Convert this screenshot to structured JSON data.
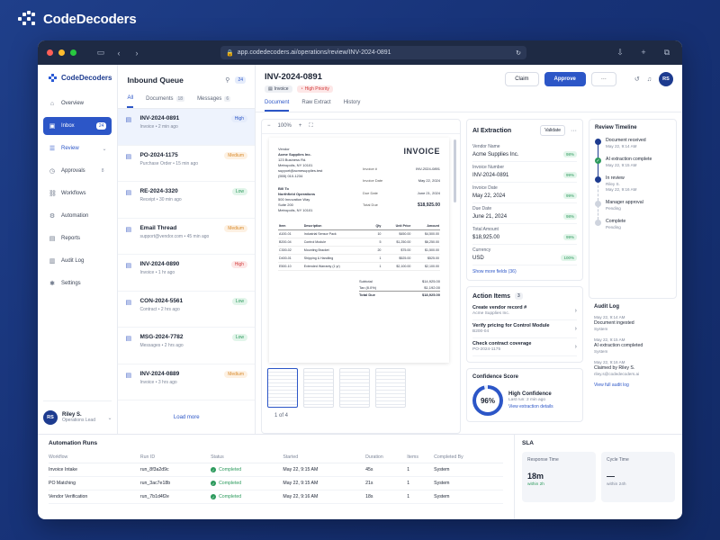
{
  "brand": {
    "name": "CodeDecoders"
  },
  "browser": {
    "url": "app.codedecoders.ai/operations/review/INV-2024-0891"
  },
  "sidebar": {
    "brand": "CodeDecoders",
    "items": [
      {
        "label": "Overview",
        "icon": "home-icon"
      },
      {
        "label": "Inbox",
        "icon": "inbox-icon",
        "count": "24"
      },
      {
        "label": "Review",
        "icon": "review-icon"
      },
      {
        "label": "Approvals",
        "icon": "approvals-icon",
        "count": "8"
      },
      {
        "label": "Workflows",
        "icon": "workflow-icon"
      },
      {
        "label": "Automation",
        "icon": "automation-icon"
      },
      {
        "label": "Reports",
        "icon": "reports-icon"
      },
      {
        "label": "Audit Log",
        "icon": "audit-icon"
      },
      {
        "label": "Settings",
        "icon": "gear-icon"
      }
    ],
    "user": {
      "initials": "RS",
      "name": "Riley S.",
      "role": "Operations Lead"
    }
  },
  "queue": {
    "title": "Inbound Queue",
    "count": "24",
    "tabs": [
      {
        "label": "All"
      },
      {
        "label": "Documents",
        "count": "18"
      },
      {
        "label": "Messages",
        "count": "6"
      }
    ],
    "items": [
      {
        "title": "INV-2024-0891",
        "sub": "Invoice • 2 min ago",
        "priority": "High",
        "kind": "high b"
      },
      {
        "title": "PO-2024-1175",
        "sub": "Purchase Order • 15 min ago",
        "priority": "Medium",
        "kind": "medium"
      },
      {
        "title": "RE-2024-3320",
        "sub": "Receipt • 30 min ago",
        "priority": "Low",
        "kind": "low"
      },
      {
        "title": "Email Thread",
        "sub": "support@vendor.com • 45 min ago",
        "priority": "Medium",
        "kind": "medium"
      },
      {
        "title": "INV-2024-0890",
        "sub": "Invoice • 1 hr ago",
        "priority": "High",
        "kind": "high"
      },
      {
        "title": "CON-2024-5561",
        "sub": "Contract • 2 hrs ago",
        "priority": "Low",
        "kind": "low"
      },
      {
        "title": "MSG-2024-7782",
        "sub": "Messages • 2 hrs ago",
        "priority": "Low",
        "kind": "low"
      },
      {
        "title": "INV-2024-0889",
        "sub": "Invoice • 3 hrs ago",
        "priority": "Medium",
        "kind": "medium"
      }
    ],
    "load_more": "Load more"
  },
  "doc": {
    "title": "INV-2024-0891",
    "tag_type": "Invoice",
    "tag_priority": "High Priority",
    "claim": "Claim",
    "approve": "Approve",
    "more": "···",
    "user_initials": "RS",
    "tabs": [
      "Document",
      "Raw Extract",
      "History"
    ],
    "zoom": "100%",
    "page_of": "1 of 4"
  },
  "invoice": {
    "heading": "INVOICE",
    "vendor_label": "Vendor",
    "vendor_name": "Acme Supplies Inc.",
    "vendor_lines": [
      "123 Business Rd.",
      "Metropolis, NY 10101",
      "support@acmesupplies.test",
      "(555) 010-1234"
    ],
    "meta": [
      {
        "k": "Invoice #",
        "v": "INV-2024-0891"
      },
      {
        "k": "Invoice Date",
        "v": "May 22, 2024"
      },
      {
        "k": "Due Date",
        "v": "June 21, 2024"
      },
      {
        "k": "Total Due",
        "v": "$18,925.00"
      }
    ],
    "bill_label": "Bill To",
    "bill_name": "Northfield Operations",
    "bill_lines": [
      "500 Innovation Way",
      "Suite 200",
      "Metropolis, NY 10101"
    ],
    "columns": [
      "Item",
      "Description",
      "Qty",
      "Unit Price",
      "Amount"
    ],
    "rows": [
      [
        "A100-01",
        "Industrial Sensor Pack",
        "10",
        "$450.00",
        "$4,500.00"
      ],
      [
        "B200-04",
        "Control Module",
        "5",
        "$1,250.00",
        "$6,250.00"
      ],
      [
        "C300-02",
        "Mounting Bracket",
        "20",
        "$75.00",
        "$1,500.00"
      ],
      [
        "D400-01",
        "Shipping & Handling",
        "1",
        "$525.00",
        "$525.00"
      ],
      [
        "E500-10",
        "Extended Warranty (1 yr)",
        "1",
        "$2,100.00",
        "$2,100.00"
      ]
    ],
    "totals": [
      {
        "k": "Subtotal",
        "v": "$14,925.00"
      },
      {
        "k": "Tax (8.0%)",
        "v": "$1,192.00"
      },
      {
        "k": "Total Due",
        "v": "$18,925.00"
      }
    ]
  },
  "ai": {
    "title": "AI Extraction",
    "validate": "Validate",
    "fields": [
      {
        "label": "Vendor Name",
        "value": "Acme Supplies Inc.",
        "conf": "98%"
      },
      {
        "label": "Invoice Number",
        "value": "INV-2024-0891",
        "conf": "99%"
      },
      {
        "label": "Invoice Date",
        "value": "May 22, 2024",
        "conf": "99%"
      },
      {
        "label": "Due Date",
        "value": "June 21, 2024",
        "conf": "98%"
      },
      {
        "label": "Total Amount",
        "value": "$18,925.00",
        "conf": "99%"
      },
      {
        "label": "Currency",
        "value": "USD",
        "conf": "100%"
      }
    ],
    "show_more": "Show more fields (36)"
  },
  "actions": {
    "title": "Action Items",
    "count": "3",
    "items": [
      {
        "title": "Create vendor record #",
        "sub": "Acme Supplies Inc."
      },
      {
        "title": "Verify pricing for Control Module",
        "sub": "B200-04"
      },
      {
        "title": "Check contract coverage",
        "sub": "PO-2024-1175"
      }
    ]
  },
  "confidence": {
    "title": "Confidence Score",
    "value": "96%",
    "percent": 96,
    "label": "High Confidence",
    "last_run": "Last run: 2 min ago",
    "link": "View extraction details"
  },
  "timeline": {
    "title": "Review Timeline",
    "items": [
      {
        "t1": "Document received",
        "t2": "May 22, 9:14 AM",
        "state": "done"
      },
      {
        "t1": "AI extraction complete",
        "t2": "May 22, 9:15 AM",
        "state": "check"
      },
      {
        "t1": "In review",
        "t2": "Riley S.",
        "t3": "May 22, 9:16 AM",
        "state": "cur"
      },
      {
        "t1": "Manager approval",
        "t2": "Pending",
        "state": "pend"
      },
      {
        "t1": "Complete",
        "t2": "Pending",
        "state": "pend"
      }
    ]
  },
  "audit": {
    "title": "Audit Log",
    "items": [
      {
        "d": "May 22, 9:14 AM",
        "e": "Document ingested",
        "s": "System"
      },
      {
        "d": "May 22, 9:15 AM",
        "e": "AI extraction completed",
        "s": "System"
      },
      {
        "d": "May 22, 9:16 AM",
        "e": "Claimed by Riley S.",
        "s": "riley.s@codedecoders.ai"
      }
    ],
    "link": "View full audit log"
  },
  "runs": {
    "title": "Automation Runs",
    "columns": [
      "Workflow",
      "Run ID",
      "Status",
      "Started",
      "Duration",
      "Items",
      "Completed By"
    ],
    "rows": [
      [
        "Invoice Intake",
        "run_8f3a2d9c",
        "Completed",
        "May 22, 9:15 AM",
        "45s",
        "1",
        "System"
      ],
      [
        "PO Matching",
        "run_3ac7e18b",
        "Completed",
        "May 22, 9:15 AM",
        "21s",
        "1",
        "System"
      ],
      [
        "Vendor Verification",
        "run_7b1d4f2e",
        "Completed",
        "May 22, 9:16 AM",
        "18s",
        "1",
        "System"
      ]
    ]
  },
  "sla": {
    "title": "SLA",
    "boxes": [
      {
        "label": "Response Time",
        "value": "18m",
        "sub": "within 2h",
        "muted": false
      },
      {
        "label": "Cycle Time",
        "value": "—",
        "sub": "within 24h",
        "muted": true
      }
    ]
  },
  "colors": {
    "accent": "#2c56c7",
    "brand_dark": "#1d3b8f",
    "success": "#2c9a5c",
    "danger": "#d23c3c",
    "warning": "#d98a2b"
  }
}
